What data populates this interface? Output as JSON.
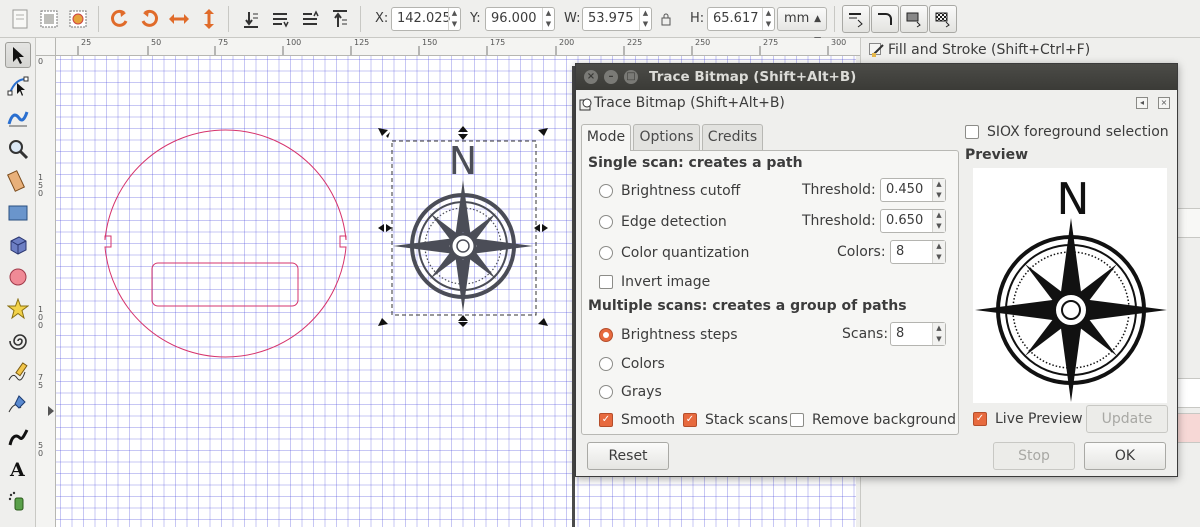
{
  "toolbar": {
    "x_label": "X:",
    "x_value": "142.025",
    "y_label": "Y:",
    "y_value": "96.000",
    "w_label": "W:",
    "w_value": "53.975",
    "h_label": "H:",
    "h_value": "65.617",
    "unit": "mm"
  },
  "ruler": {
    "top_ticks": [
      "25",
      "50",
      "75",
      "100",
      "125",
      "150",
      "175",
      "200",
      "225",
      "250",
      "275",
      "300"
    ],
    "left_ticks": [
      "0",
      "1 5 0",
      "1 0 0",
      "7 5",
      "5 0"
    ]
  },
  "dock": {
    "title": "Fill and Stroke (Shift+Ctrl+F)"
  },
  "trace_dialog": {
    "window_title": "Trace Bitmap (Shift+Alt+B)",
    "panel_title": "Trace Bitmap (Shift+Alt+B)",
    "tabs": [
      {
        "label": "Mode",
        "active": true
      },
      {
        "label": "Options",
        "active": false
      },
      {
        "label": "Credits",
        "active": false
      }
    ],
    "single_scan_title": "Single scan: creates a path",
    "brightness_cutoff": "Brightness cutoff",
    "threshold_label": "Threshold:",
    "brightness_threshold": "0.450",
    "edge_detection": "Edge detection",
    "edge_threshold": "0.650",
    "color_quantization": "Color quantization",
    "colors_label": "Colors:",
    "colors_value": "8",
    "invert_image": "Invert image",
    "multiple_scans_title": "Multiple scans: creates a group of paths",
    "brightness_steps": "Brightness steps",
    "scans_label": "Scans:",
    "scans_value": "8",
    "colors_option": "Colors",
    "grays_option": "Grays",
    "smooth": "Smooth",
    "stack_scans": "Stack scans",
    "remove_background": "Remove background",
    "siox": "SIOX foreground selection",
    "preview_label": "Preview",
    "live_preview": "Live Preview",
    "update": "Update",
    "reset": "Reset",
    "stop": "Stop",
    "ok": "OK",
    "selected_mode": "brightness_steps",
    "smooth_checked": true,
    "stack_scans_checked": true,
    "remove_background_checked": false,
    "invert_image_checked": false,
    "siox_checked": false,
    "live_preview_checked": true
  },
  "canvas": {
    "compass_letter": "N",
    "preview_letter": "N"
  },
  "colors": {
    "accent": "#e76a3e",
    "shape_stroke": "#d6336c",
    "compass": "#4b4d57",
    "grid": "#8a8ae6"
  }
}
